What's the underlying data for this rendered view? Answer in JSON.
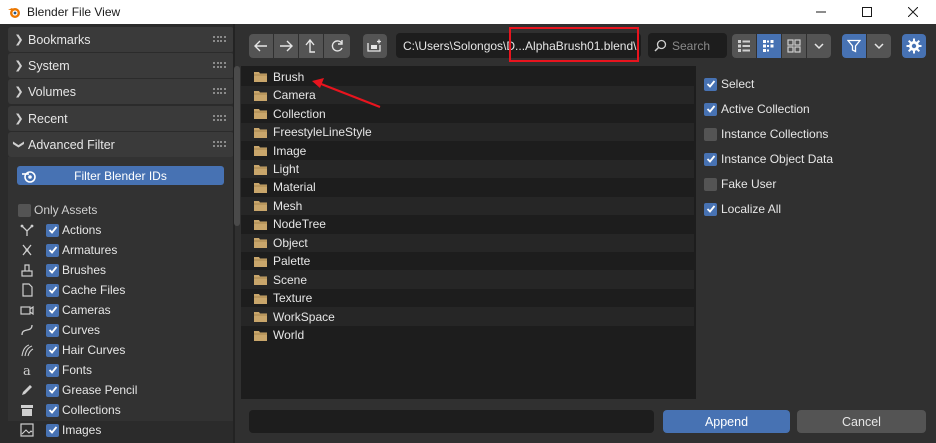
{
  "window": {
    "title": "Blender File View"
  },
  "sidebar": {
    "panels": [
      {
        "label": "Bookmarks",
        "expanded": false
      },
      {
        "label": "System",
        "expanded": false
      },
      {
        "label": "Volumes",
        "expanded": false
      },
      {
        "label": "Recent",
        "expanded": false
      },
      {
        "label": "Advanced Filter",
        "expanded": true
      }
    ],
    "filter_button": "Filter Blender IDs",
    "only_assets": {
      "label": "Only Assets",
      "checked": false
    },
    "filters": [
      {
        "label": "Actions",
        "icon": "action-icon",
        "checked": true
      },
      {
        "label": "Armatures",
        "icon": "armature-icon",
        "checked": true
      },
      {
        "label": "Brushes",
        "icon": "brush-icon",
        "checked": true
      },
      {
        "label": "Cache Files",
        "icon": "file-icon",
        "checked": true
      },
      {
        "label": "Cameras",
        "icon": "camera-icon",
        "checked": true
      },
      {
        "label": "Curves",
        "icon": "curve-icon",
        "checked": true
      },
      {
        "label": "Hair Curves",
        "icon": "hair-icon",
        "checked": true
      },
      {
        "label": "Fonts",
        "icon": "font-icon",
        "checked": true
      },
      {
        "label": "Grease Pencil",
        "icon": "pencil-icon",
        "checked": true
      },
      {
        "label": "Collections",
        "icon": "collection-icon",
        "checked": true
      },
      {
        "label": "Images",
        "icon": "image-icon",
        "checked": true
      }
    ]
  },
  "toolbar": {
    "path": "C:\\Users\\Solongos\\D...AlphaBrush01.blend\\",
    "search_placeholder": "Search"
  },
  "files": [
    "Brush",
    "Camera",
    "Collection",
    "FreestyleLineStyle",
    "Image",
    "Light",
    "Material",
    "Mesh",
    "NodeTree",
    "Object",
    "Palette",
    "Scene",
    "Texture",
    "WorkSpace",
    "World"
  ],
  "options": [
    {
      "label": "Select",
      "checked": true
    },
    {
      "label": "Active Collection",
      "checked": true
    },
    {
      "label": "Instance Collections",
      "checked": false
    },
    {
      "label": "Instance Object Data",
      "checked": true
    },
    {
      "label": "Fake User",
      "checked": false
    },
    {
      "label": "Localize All",
      "checked": true
    }
  ],
  "footer": {
    "filename_value": "",
    "append_label": "Append",
    "cancel_label": "Cancel"
  },
  "colors": {
    "accent": "#4772b3",
    "annotation": "#e8141e",
    "folder": "#c9a66b"
  }
}
